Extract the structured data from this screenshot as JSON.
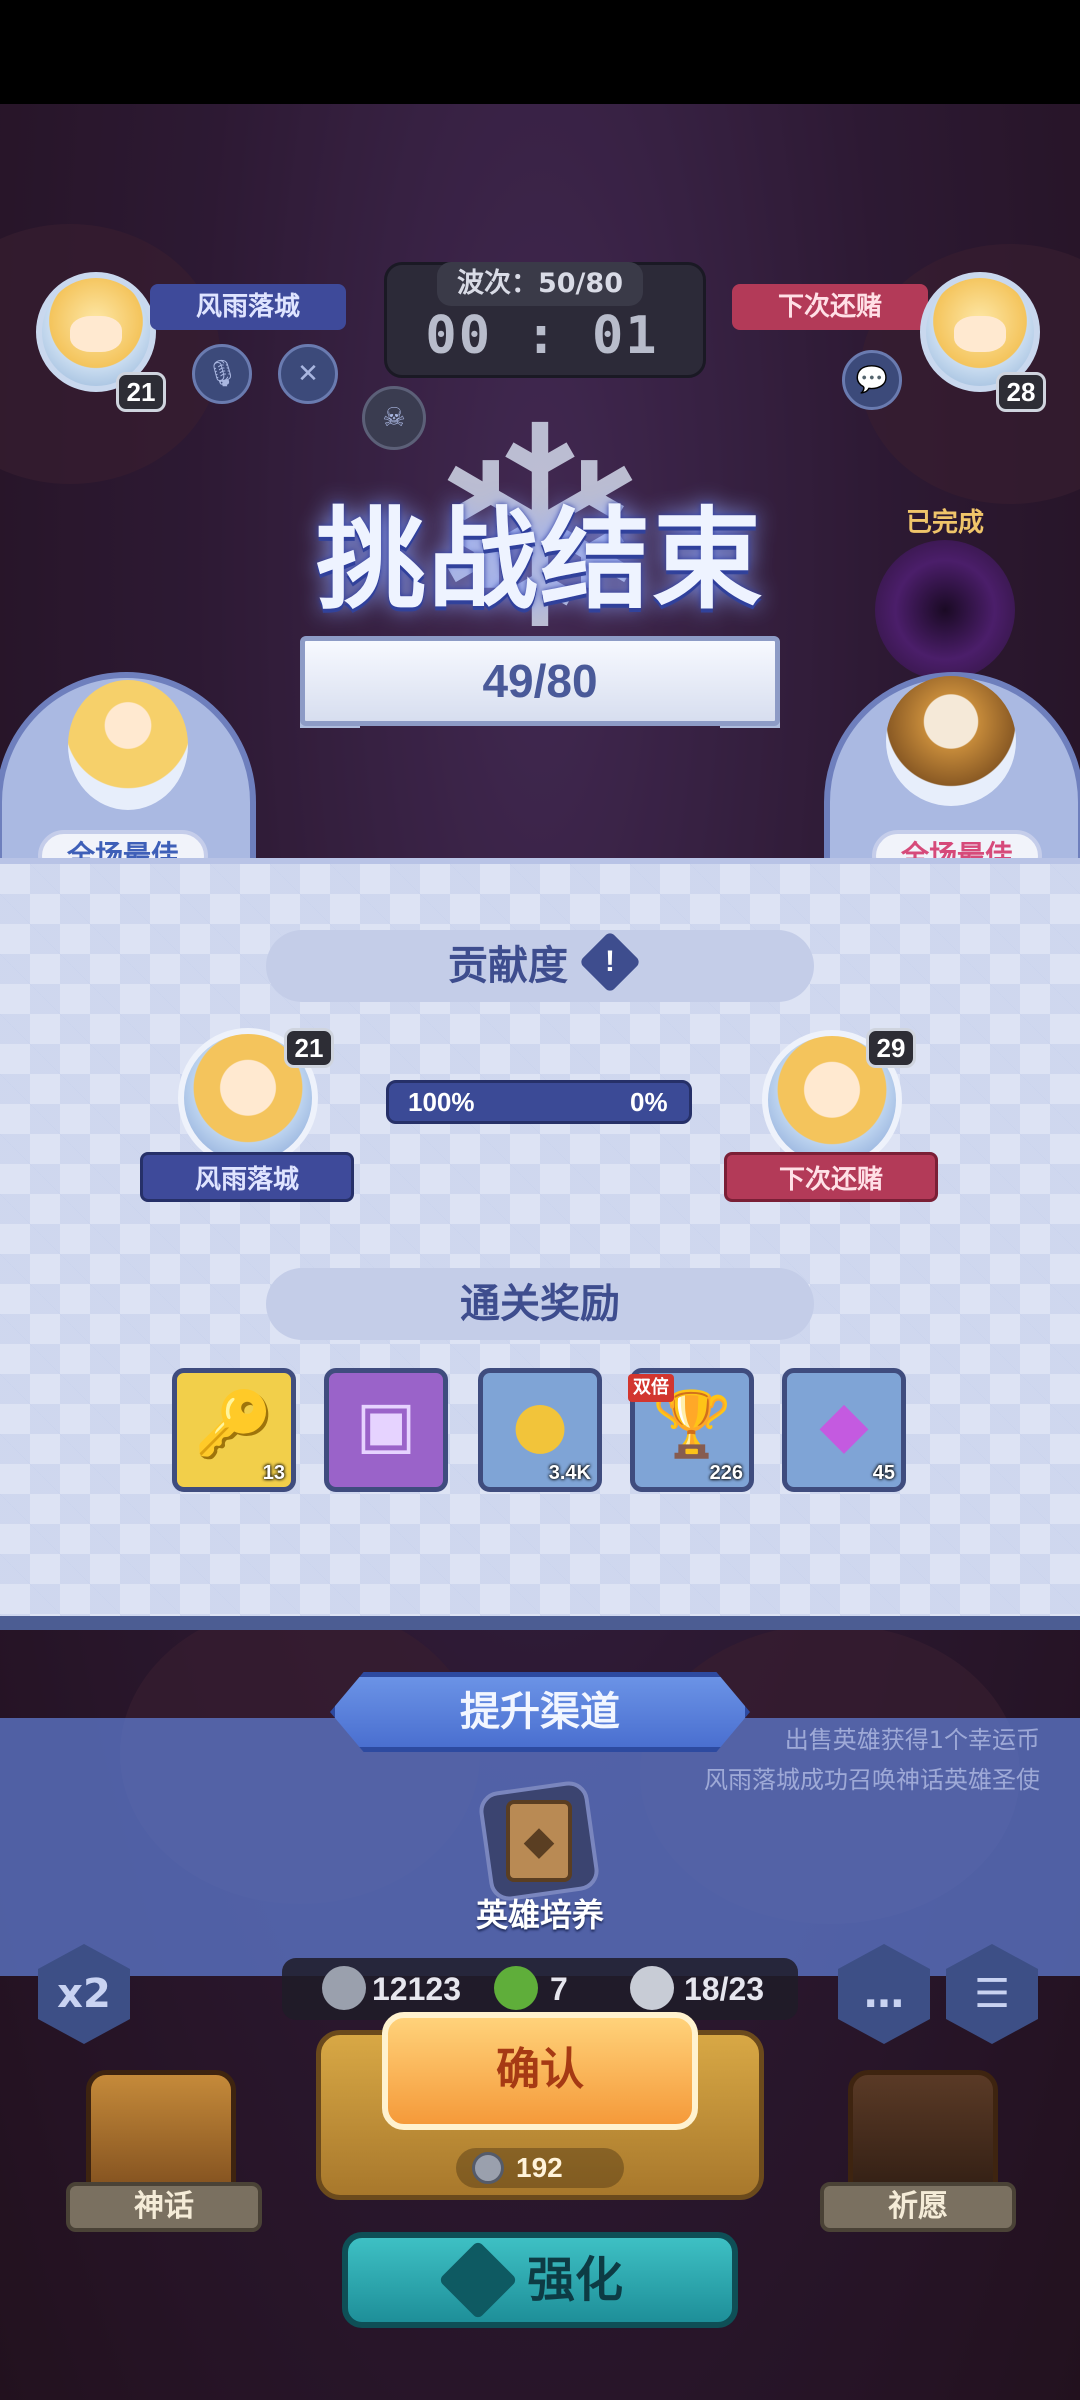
{
  "hud": {
    "player1": {
      "name": "风雨落城",
      "level": "21"
    },
    "player2": {
      "name": "下次还赌",
      "level": "28"
    },
    "wave_label": "波次：50/80",
    "timer": "00 : 01"
  },
  "result": {
    "title": "挑战结束",
    "score": "49/80",
    "completed_label": "已完成"
  },
  "mvp": {
    "left_label": "全场最佳",
    "right_label": "全场最佳"
  },
  "contribution": {
    "header": "贡献度",
    "info_glyph": "!",
    "left_player": {
      "name": "风雨落城",
      "level": "21",
      "percent": "100%"
    },
    "right_player": {
      "name": "下次还赌",
      "level": "29",
      "percent": "0%"
    }
  },
  "rewards": {
    "header": "通关奖励",
    "double_tag": "双倍",
    "items": [
      {
        "icon": "key-icon",
        "glyph": "🔑",
        "qty": "13",
        "bg": "#f2cf4a"
      },
      {
        "icon": "chest-icon",
        "glyph": "▣",
        "qty": "",
        "bg": "#9a63c9"
      },
      {
        "icon": "coin-icon",
        "glyph": "●",
        "qty": "3.4K",
        "bg": "#7fa4d6"
      },
      {
        "icon": "trophy-icon",
        "glyph": "🏆",
        "qty": "226",
        "bg": "#7fa4d6"
      },
      {
        "icon": "crystal-icon",
        "glyph": "◆",
        "qty": "45",
        "bg": "#7fa4d6"
      }
    ]
  },
  "boost": {
    "banner": "提升渠道",
    "card_label": "英雄培养",
    "ticker_1": "出售英雄获得1个幸运币",
    "ticker_2": "风雨落城成功召唤神话英雄圣使"
  },
  "resources": {
    "silver": "12123",
    "clover": "7",
    "units": "18/23"
  },
  "actions": {
    "speed_label": "x2",
    "confirm": "确认",
    "cost": "192",
    "upgrade": "强化",
    "myth": "神话",
    "pray": "祈愿"
  },
  "colors": {
    "accent_blue": "#3e4d8e",
    "mvp_blue": "#3e5fb8",
    "mvp_pink": "#d64a7a",
    "confirm_orange": "#f59a3a",
    "upgrade_teal": "#1e8f99"
  }
}
